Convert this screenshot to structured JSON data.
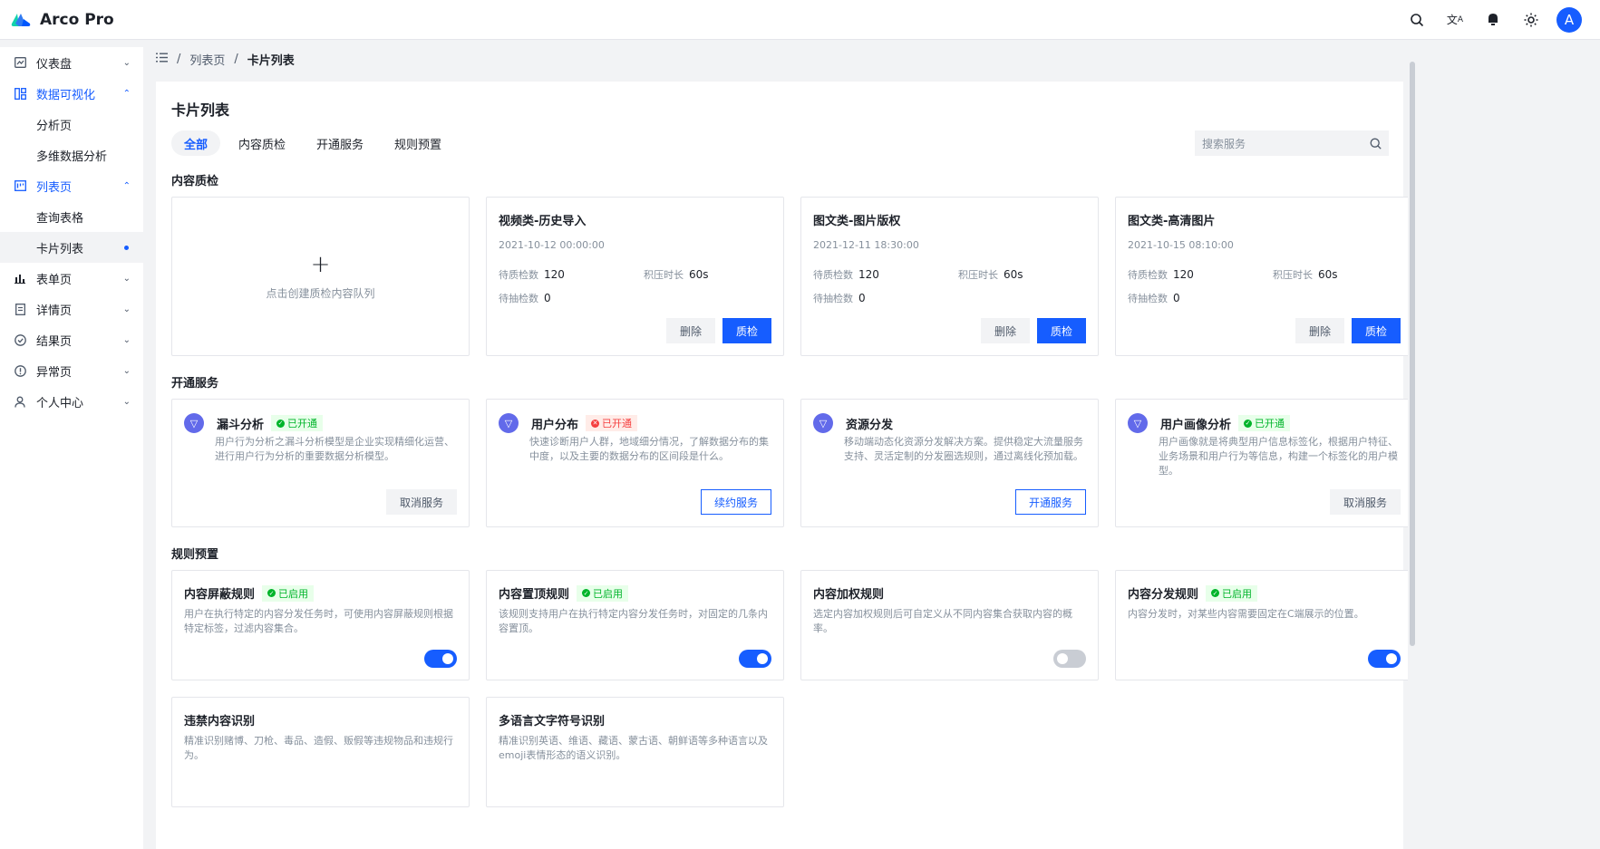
{
  "app": {
    "name": "Arco Pro",
    "avatar_letter": "A",
    "accent": "#165dff"
  },
  "nav": {
    "icons": [
      "search-icon",
      "language-icon",
      "notification-icon",
      "theme-icon"
    ]
  },
  "sidebar": {
    "items": [
      {
        "label": "仪表盘",
        "icon": "dashboard-icon"
      },
      {
        "label": "数据可视化",
        "icon": "visualization-icon",
        "sub": [
          "分析页",
          "多维数据分析"
        ]
      },
      {
        "label": "列表页",
        "icon": "list-icon",
        "sub": [
          "查询表格",
          "卡片列表"
        ]
      },
      {
        "label": "表单页",
        "icon": "form-icon"
      },
      {
        "label": "详情页",
        "icon": "detail-icon"
      },
      {
        "label": "结果页",
        "icon": "result-icon"
      },
      {
        "label": "异常页",
        "icon": "exception-icon"
      },
      {
        "label": "个人中心",
        "icon": "user-icon"
      }
    ]
  },
  "breadcrumb": {
    "parent": "列表页",
    "current": "卡片列表"
  },
  "page": {
    "title": "卡片列表",
    "tabs": [
      "全部",
      "内容质检",
      "开通服务",
      "规则预置"
    ],
    "search_placeholder": "搜索服务"
  },
  "quality": {
    "section": "内容质检",
    "add_text": "点击创建质检内容队列",
    "labels": {
      "pending": "待质检数",
      "backlog": "积压时长",
      "sampling": "待抽检数"
    },
    "buttons": {
      "delete": "删除",
      "inspect": "质检"
    },
    "cards": [
      {
        "title": "视频类-历史导入",
        "date": "2021-10-12 00:00:00",
        "pending": "120",
        "backlog": "60s",
        "sampling": "0"
      },
      {
        "title": "图文类-图片版权",
        "date": "2021-12-11 18:30:00",
        "pending": "120",
        "backlog": "60s",
        "sampling": "0"
      },
      {
        "title": "图文类-高清图片",
        "date": "2021-10-15 08:10:00",
        "pending": "120",
        "backlog": "60s",
        "sampling": "0"
      }
    ]
  },
  "services": {
    "section": "开通服务",
    "cards": [
      {
        "title": "漏斗分析",
        "tag": "已开通",
        "tag_status": "green",
        "desc": "用户行为分析之漏斗分析模型是企业实现精细化运营、进行用户行为分析的重要数据分析模型。",
        "button": "取消服务",
        "button_style": "secondary"
      },
      {
        "title": "用户分布",
        "tag": "已开通",
        "tag_status": "red",
        "desc": "快速诊断用户人群，地域细分情况，了解数据分布的集中度，以及主要的数据分布的区间段是什么。",
        "button": "续约服务",
        "button_style": "outline"
      },
      {
        "title": "资源分发",
        "tag": "",
        "tag_status": "",
        "desc": "移动端动态化资源分发解决方案。提供稳定大流量服务支持、灵活定制的分发圈选规则，通过离线化预加载。",
        "button": "开通服务",
        "button_style": "outline"
      },
      {
        "title": "用户画像分析",
        "tag": "已开通",
        "tag_status": "green",
        "desc": "用户画像就是将典型用户信息标签化，根据用户特征、业务场景和用户行为等信息，构建一个标签化的用户模型。",
        "button": "取消服务",
        "button_style": "secondary"
      }
    ]
  },
  "rules": {
    "section": "规则预置",
    "cards": [
      {
        "title": "内容屏蔽规则",
        "tag": "已启用",
        "desc": "用户在执行特定的内容分发任务时，可使用内容屏蔽规则根据特定标签，过滤内容集合。",
        "enabled": true
      },
      {
        "title": "内容置顶规则",
        "tag": "已启用",
        "desc": "该规则支持用户在执行特定内容分发任务时，对固定的几条内容置顶。",
        "enabled": true
      },
      {
        "title": "内容加权规则",
        "tag": "",
        "desc": "选定内容加权规则后可自定义从不同内容集合获取内容的概率。",
        "enabled": false
      },
      {
        "title": "内容分发规则",
        "tag": "已启用",
        "desc": "内容分发时，对某些内容需要固定在C端展示的位置。",
        "enabled": true
      },
      {
        "title": "违禁内容识别",
        "tag": "",
        "desc": "精准识别赌博、刀枪、毒品、造假、贩假等违规物品和违规行为。",
        "enabled": null
      },
      {
        "title": "多语言文字符号识别",
        "tag": "",
        "desc": "精准识别英语、维语、藏语、蒙古语、朝鲜语等多种语言以及emoji表情形态的语义识别。",
        "enabled": null
      }
    ]
  }
}
